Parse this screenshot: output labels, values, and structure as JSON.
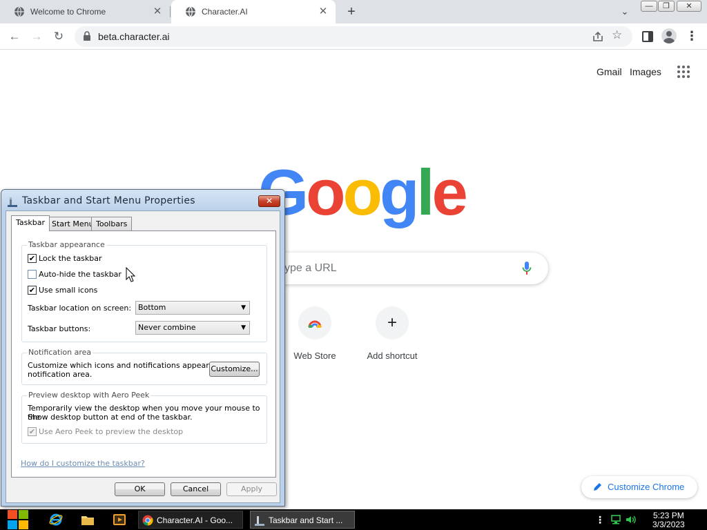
{
  "browser": {
    "tabs": [
      {
        "title": "Welcome to Chrome",
        "icon": "globe-icon",
        "active": false
      },
      {
        "title": "Character.AI",
        "icon": "globe-icon",
        "active": true
      }
    ],
    "new_tab": "+",
    "tab_close": "✕",
    "url": "beta.character.ai",
    "window_controls": {
      "minimize": "▭",
      "maximize": "❐",
      "close": "✕"
    }
  },
  "ntp": {
    "gmail": "Gmail",
    "images": "Images",
    "logo_letters": [
      {
        "ch": "G",
        "color": "#4285f4"
      },
      {
        "ch": "o",
        "color": "#ea4335"
      },
      {
        "ch": "o",
        "color": "#fbbc05"
      },
      {
        "ch": "g",
        "color": "#4285f4"
      },
      {
        "ch": "l",
        "color": "#34a853"
      },
      {
        "ch": "e",
        "color": "#ea4335"
      }
    ],
    "search_placeholder": "ype a URL",
    "shortcuts": [
      {
        "label": "Web Store",
        "icon": "web-store-icon"
      },
      {
        "label": "Add shortcut",
        "icon": "plus-icon",
        "glyph": "+"
      }
    ],
    "customize_label": "Customize Chrome"
  },
  "dialog": {
    "title": "Taskbar and Start Menu Properties",
    "close": "✕",
    "tabs": [
      "Taskbar",
      "Start Menu",
      "Toolbars"
    ],
    "appearance": {
      "title": "Taskbar appearance",
      "lock_label": "Lock the taskbar",
      "lock_checked": true,
      "autohide_label": "Auto-hide the taskbar",
      "autohide_checked": false,
      "small_icons_label": "Use small icons",
      "small_icons_checked": true,
      "location_label": "Taskbar location on screen:",
      "location_value": "Bottom",
      "buttons_label": "Taskbar buttons:",
      "buttons_value": "Never combine"
    },
    "notification": {
      "title": "Notification area",
      "text_line1": "Customize which icons and notifications appear in the",
      "text_line2": "notification area.",
      "customize_button": "Customize..."
    },
    "peek": {
      "title": "Preview desktop with Aero Peek",
      "text_line1": "Temporarily view the desktop when you move your mouse to the",
      "text_line2": "Show desktop button at end of the taskbar.",
      "checkbox_label": "Use Aero Peek to preview the desktop",
      "checked": true
    },
    "help_link": "How do I customize the taskbar?",
    "ok": "OK",
    "cancel": "Cancel",
    "apply": "Apply"
  },
  "taskbar": {
    "tasks": [
      {
        "label": "Character.AI - Goo...",
        "icon": "chrome-icon"
      },
      {
        "label": "Taskbar and Start ...",
        "icon": "properties-icon"
      }
    ],
    "time": "5:23 PM",
    "date": "3/3/2023"
  },
  "colors": {
    "google_blue": "#4285f4",
    "link_blue": "#1a73e8",
    "taskbar_bg": "#000000"
  }
}
